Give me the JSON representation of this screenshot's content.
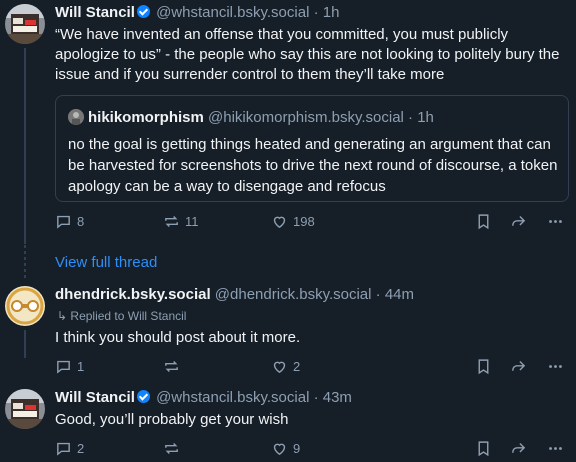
{
  "posts": [
    {
      "name": "Will Stancil",
      "verified": true,
      "handle": "@whstancil.bsky.social",
      "time": "· 1h",
      "text": "“We have invented an offense that you committed, you must publicly apologize to us” - the people who say this are not looking to politely bury the issue and if you surrender control to them they’ll take more",
      "quote": {
        "name": "hikikomorphism",
        "handle": "@hikikomorphism.bsky.social",
        "time": "· 1h",
        "text": "no the goal is getting things heated and generating an argument that can be harvested for screenshots to drive the next round of discourse, a token apology can be a way to disengage and refocus"
      },
      "replies": "8",
      "reposts": "11",
      "likes": "198"
    },
    {
      "name": "dhendrick.bsky.social",
      "handle": "@dhendrick.bsky.social",
      "time": "· 44m",
      "replied_to": "Replied to Will Stancil",
      "text": "I think you should post about it more.",
      "replies": "1",
      "reposts": "",
      "likes": "2"
    },
    {
      "name": "Will Stancil",
      "verified": true,
      "handle": "@whstancil.bsky.social",
      "time": "· 43m",
      "text": "Good, you’ll probably get your wish",
      "replies": "2",
      "reposts": "",
      "likes": "9"
    }
  ],
  "view_full_thread": "View full thread",
  "colors": {
    "background": "#161e27",
    "link": "#2e8ff7",
    "muted": "#8d9fb2",
    "verified": "#1083fe"
  }
}
